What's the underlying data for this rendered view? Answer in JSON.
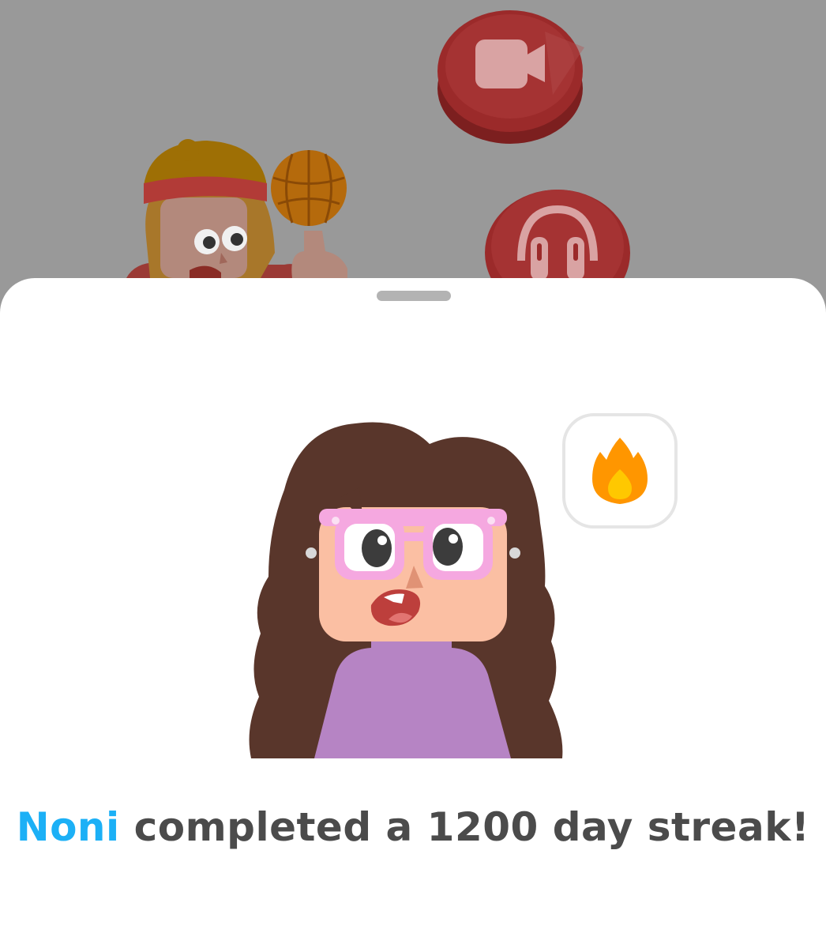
{
  "notification": {
    "friend_name": "Noni",
    "message": " completed a 1200 day streak!",
    "streak_days": 1200
  },
  "background": {
    "buttons": [
      {
        "icon": "video-camera-icon"
      },
      {
        "icon": "headphones-icon"
      }
    ],
    "character": "basketball-character"
  },
  "bubble_icon": "fire-icon",
  "colors": {
    "name_accent": "#1cb0f6",
    "text": "#4b4b4b",
    "overlay": "#999999",
    "fire_outer": "#ff9600",
    "fire_inner": "#ffc800"
  }
}
